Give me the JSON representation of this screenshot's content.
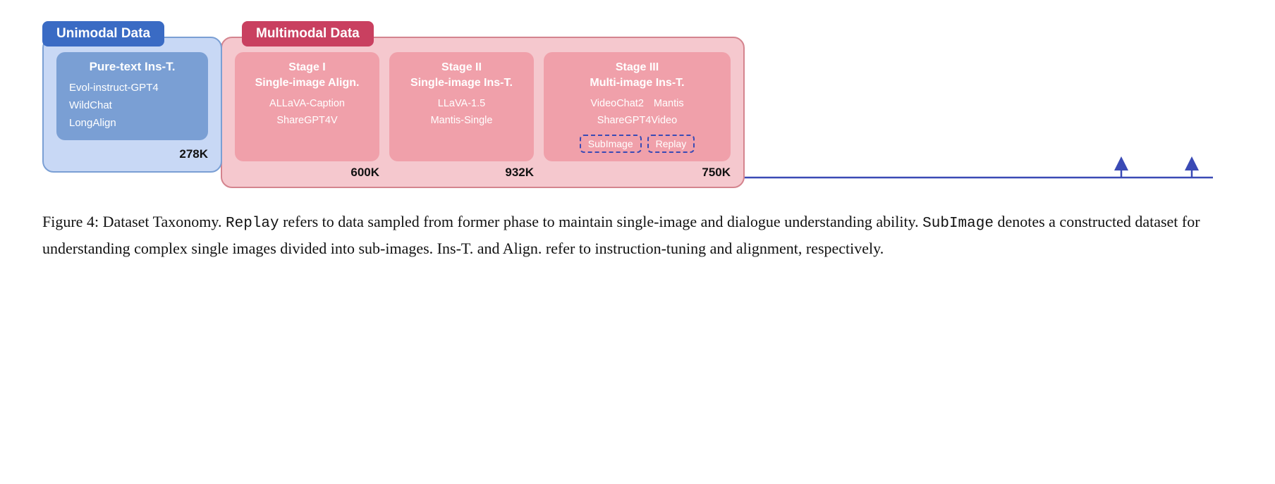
{
  "unimodal": {
    "section_label": "Unimodal Data",
    "box_title": "Pure-text Ins-T.",
    "items": [
      "Evol-instruct-GPT4",
      "WildChat",
      "LongAlign"
    ],
    "count": "278K"
  },
  "multimodal": {
    "section_label": "Multimodal Data",
    "stages": [
      {
        "id": "stage1",
        "title": "Stage I\nSingle-image Align.",
        "items": [
          "ALLaVA-Caption",
          "ShareGPT4V"
        ],
        "count": "600K"
      },
      {
        "id": "stage2",
        "title": "Stage II\nSingle-image Ins-T.",
        "items": [
          "LLaVA-1.5",
          "Mantis-Single"
        ],
        "count": "932K"
      },
      {
        "id": "stage3",
        "title": "Stage III\nMulti-image Ins-T.",
        "items_row1": [
          "VideoChat2",
          "Mantis"
        ],
        "items_row2": [
          "ShareGPT4Video"
        ],
        "dashed_items": [
          "SubImage",
          "Replay"
        ],
        "count": "750K"
      }
    ]
  },
  "caption": {
    "figure_label": "Figure 4:",
    "text_parts": [
      " Dataset Taxonomy. ",
      "Replay",
      " refers to data sampled from former phase to maintain single-image and dialogue understanding ability. ",
      "SubImage",
      " denotes a constructed dataset for understanding complex single images divided into sub-images.  Ins-T. and Align.  refer to instruction-tuning and alignment, respectively."
    ]
  },
  "colors": {
    "blue_dark": "#3a6bc4",
    "blue_mid": "#7a9fd4",
    "blue_light": "#c8d8f5",
    "red_dark": "#c94060",
    "red_mid": "#f0a0aa",
    "red_light": "#f5c8ce",
    "dashed_border": "#3a4ab5",
    "white": "#ffffff",
    "black": "#111111"
  }
}
